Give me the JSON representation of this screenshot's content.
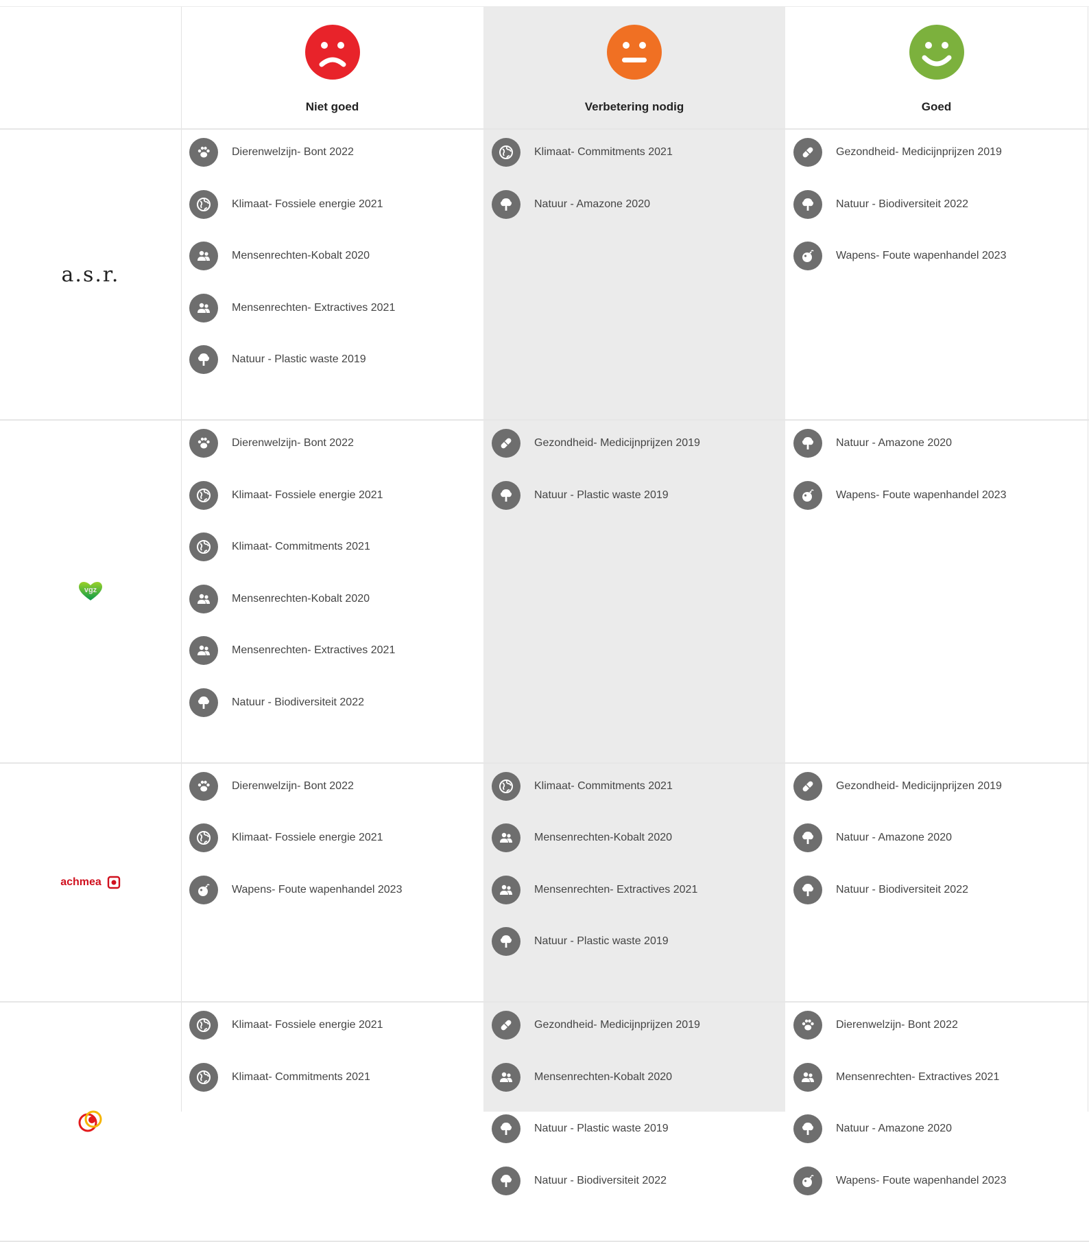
{
  "header": {
    "columns": [
      {
        "label": "Niet goed",
        "mood": "sad",
        "color": "#e8232a"
      },
      {
        "label": "Verbetering nodig",
        "mood": "neutral",
        "color": "#f07023"
      },
      {
        "label": "Goed",
        "mood": "happy",
        "color": "#7cb13d"
      }
    ]
  },
  "rows": [
    {
      "logo": {
        "kind": "asr",
        "text": "a.s.r."
      },
      "niet_goed": [
        {
          "icon": "paw-icon",
          "label": "Dierenwelzijn- Bont 2022"
        },
        {
          "icon": "globe-icon",
          "label": "Klimaat- Fossiele energie 2021"
        },
        {
          "icon": "people-icon",
          "label": "Mensenrechten-Kobalt 2020"
        },
        {
          "icon": "people-icon",
          "label": "Mensenrechten- Extractives 2021"
        },
        {
          "icon": "tree-icon",
          "label": "Natuur - Plastic waste 2019"
        }
      ],
      "verbetering": [
        {
          "icon": "globe-icon",
          "label": "Klimaat- Commitments 2021"
        },
        {
          "icon": "tree-icon",
          "label": "Natuur - Amazone 2020"
        }
      ],
      "goed": [
        {
          "icon": "pill-icon",
          "label": "Gezondheid- Medicijnprijzen 2019"
        },
        {
          "icon": "tree-icon",
          "label": "Natuur - Biodiversiteit 2022"
        },
        {
          "icon": "bomb-icon",
          "label": "Wapens- Foute wapenhandel 2023"
        }
      ]
    },
    {
      "logo": {
        "kind": "vgz",
        "text": "vgz"
      },
      "niet_goed": [
        {
          "icon": "paw-icon",
          "label": "Dierenwelzijn- Bont 2022"
        },
        {
          "icon": "globe-icon",
          "label": "Klimaat- Fossiele energie 2021"
        },
        {
          "icon": "globe-icon",
          "label": "Klimaat- Commitments 2021"
        },
        {
          "icon": "people-icon",
          "label": "Mensenrechten-Kobalt 2020"
        },
        {
          "icon": "people-icon",
          "label": "Mensenrechten- Extractives 2021"
        },
        {
          "icon": "tree-icon",
          "label": "Natuur - Biodiversiteit 2022"
        }
      ],
      "verbetering": [
        {
          "icon": "pill-icon",
          "label": "Gezondheid- Medicijnprijzen 2019"
        },
        {
          "icon": "tree-icon",
          "label": "Natuur - Plastic waste 2019"
        }
      ],
      "goed": [
        {
          "icon": "tree-icon",
          "label": "Natuur - Amazone 2020"
        },
        {
          "icon": "bomb-icon",
          "label": "Wapens- Foute wapenhandel 2023"
        }
      ]
    },
    {
      "logo": {
        "kind": "achmea",
        "text": "achmea"
      },
      "niet_goed": [
        {
          "icon": "paw-icon",
          "label": "Dierenwelzijn- Bont 2022"
        },
        {
          "icon": "globe-icon",
          "label": "Klimaat- Fossiele energie 2021"
        },
        {
          "icon": "bomb-icon",
          "label": "Wapens- Foute wapenhandel 2023"
        }
      ],
      "verbetering": [
        {
          "icon": "globe-icon",
          "label": "Klimaat- Commitments 2021"
        },
        {
          "icon": "people-icon",
          "label": "Mensenrechten-Kobalt 2020"
        },
        {
          "icon": "people-icon",
          "label": "Mensenrechten- Extractives 2021"
        },
        {
          "icon": "tree-icon",
          "label": "Natuur - Plastic waste 2019"
        }
      ],
      "goed": [
        {
          "icon": "pill-icon",
          "label": "Gezondheid- Medicijnprijzen 2019"
        },
        {
          "icon": "tree-icon",
          "label": "Natuur - Amazone 2020"
        },
        {
          "icon": "tree-icon",
          "label": "Natuur - Biodiversiteit 2022"
        }
      ]
    },
    {
      "logo": {
        "kind": "ohra",
        "text": ""
      },
      "niet_goed": [
        {
          "icon": "globe-icon",
          "label": "Klimaat- Fossiele energie 2021"
        },
        {
          "icon": "globe-icon",
          "label": "Klimaat- Commitments 2021"
        }
      ],
      "verbetering": [
        {
          "icon": "pill-icon",
          "label": "Gezondheid- Medicijnprijzen 2019"
        },
        {
          "icon": "people-icon",
          "label": "Mensenrechten-Kobalt 2020"
        },
        {
          "icon": "tree-icon",
          "label": "Natuur - Plastic waste 2019"
        },
        {
          "icon": "tree-icon",
          "label": "Natuur - Biodiversiteit 2022"
        }
      ],
      "goed": [
        {
          "icon": "paw-icon",
          "label": "Dierenwelzijn- Bont 2022"
        },
        {
          "icon": "people-icon",
          "label": "Mensenrechten- Extractives 2021"
        },
        {
          "icon": "tree-icon",
          "label": "Natuur - Amazone 2020"
        },
        {
          "icon": "bomb-icon",
          "label": "Wapens- Foute wapenhandel 2023"
        }
      ]
    }
  ]
}
